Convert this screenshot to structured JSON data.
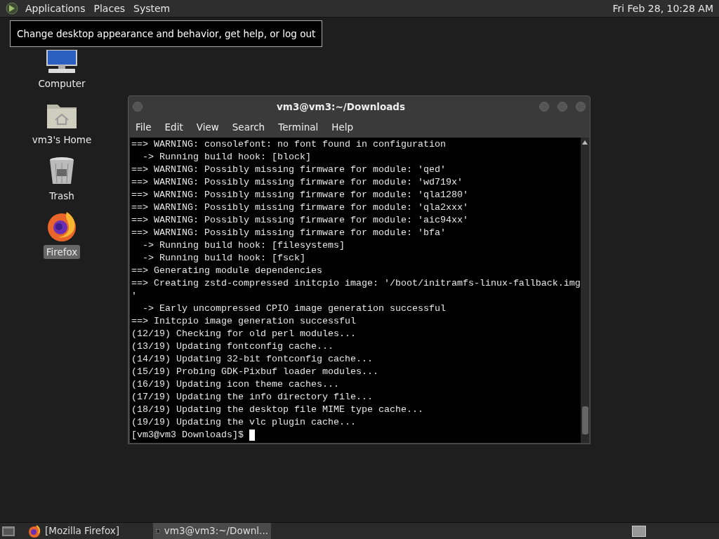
{
  "top_panel": {
    "menus": [
      {
        "label": "Applications"
      },
      {
        "label": "Places"
      },
      {
        "label": "System"
      }
    ],
    "clock": "Fri Feb 28, 10:28 AM"
  },
  "tooltip": "Change desktop appearance and behavior, get help, or log out",
  "desktop_icons": [
    {
      "kind": "computer",
      "label": "Computer",
      "selected": false
    },
    {
      "kind": "home",
      "label": "vm3's Home",
      "selected": false
    },
    {
      "kind": "trash",
      "label": "Trash",
      "selected": false
    },
    {
      "kind": "firefox",
      "label": "Firefox",
      "selected": true
    }
  ],
  "terminal": {
    "title": "vm3@vm3:~/Downloads",
    "menu": [
      "File",
      "Edit",
      "View",
      "Search",
      "Terminal",
      "Help"
    ],
    "lines": [
      "==> WARNING: consolefont: no font found in configuration",
      "  -> Running build hook: [block]",
      "==> WARNING: Possibly missing firmware for module: 'qed'",
      "==> WARNING: Possibly missing firmware for module: 'wd719x'",
      "==> WARNING: Possibly missing firmware for module: 'qla1280'",
      "==> WARNING: Possibly missing firmware for module: 'qla2xxx'",
      "==> WARNING: Possibly missing firmware for module: 'aic94xx'",
      "==> WARNING: Possibly missing firmware for module: 'bfa'",
      "  -> Running build hook: [filesystems]",
      "  -> Running build hook: [fsck]",
      "==> Generating module dependencies",
      "==> Creating zstd-compressed initcpio image: '/boot/initramfs-linux-fallback.img",
      "'",
      "  -> Early uncompressed CPIO image generation successful",
      "==> Initcpio image generation successful",
      "(12/19) Checking for old perl modules...",
      "(13/19) Updating fontconfig cache...",
      "(14/19) Updating 32-bit fontconfig cache...",
      "(15/19) Probing GDK-Pixbuf loader modules...",
      "(16/19) Updating icon theme caches...",
      "(17/19) Updating the info directory file...",
      "(18/19) Updating the desktop file MIME type cache...",
      "(19/19) Updating the vlc plugin cache..."
    ],
    "prompt": "[vm3@vm3 Downloads]$ "
  },
  "taskbar": {
    "items": [
      {
        "kind": "firefox",
        "label": "[Mozilla Firefox]",
        "selected": false
      },
      {
        "kind": "terminal",
        "label": "vm3@vm3:~/Downl...",
        "selected": true
      }
    ]
  }
}
